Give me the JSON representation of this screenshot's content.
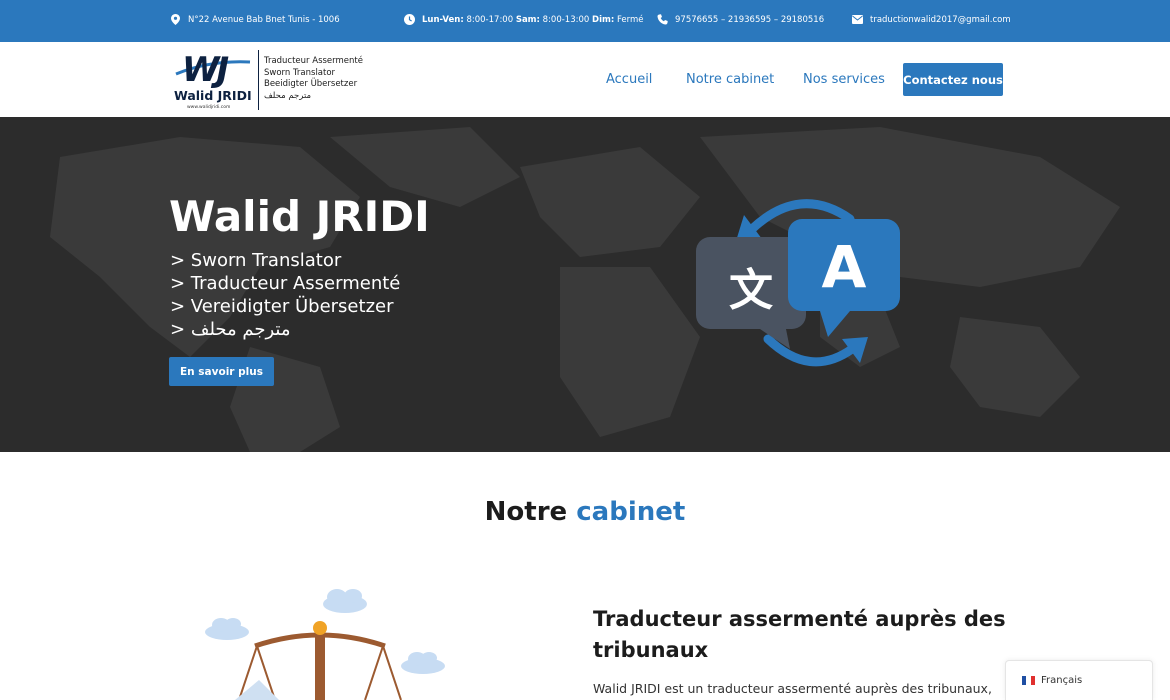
{
  "topbar": {
    "address": "N°22 Avenue Bab Bnet Tunis - 1006",
    "hours_label1": "Lun-Ven:",
    "hours_value1": "8:00-17:00",
    "hours_label2": "Sam:",
    "hours_value2": "8:00-13:00",
    "hours_label3": "Dim:",
    "hours_value3": "Fermé",
    "phones": "97576655 – 21936595 – 29180516",
    "email": "traductionwalid2017@gmail.com",
    "icons": [
      "map-pin-icon",
      "clock-icon",
      "phone-icon",
      "envelope-icon"
    ]
  },
  "logo": {
    "mark": "WJ",
    "name": "Walid JRIDI",
    "url": "www.walidjridi.com",
    "line1": "Traducteur Assermenté",
    "line2": "Sworn Translator",
    "line3": "Beeidigter Übersetzer",
    "line4": "مترجم محلف"
  },
  "nav": {
    "items": [
      "Accueil",
      "Notre cabinet",
      "Nos services"
    ],
    "cta": "Contactez nous"
  },
  "hero": {
    "title": "Walid JRIDI",
    "lines": [
      "> Sworn Translator",
      "> Traducteur Assermenté",
      "> Vereidigter Übersetzer",
      "> مترجم محلف"
    ],
    "button": "En savoir plus",
    "illustration": {
      "left_glyph": "文",
      "right_glyph": "A"
    }
  },
  "section": {
    "title_main": "Notre",
    "title_accent": "cabinet",
    "feature_title": "Traducteur assermenté auprès des tribunaux",
    "feature_text": "Walid JRIDI est un traducteur assermenté auprès des tribunaux,"
  },
  "language_switcher": {
    "label": "Français"
  },
  "colors": {
    "brand_blue": "#2b78bd",
    "hero_bg": "#2c2c2c",
    "dark_navy": "#0d2140"
  }
}
